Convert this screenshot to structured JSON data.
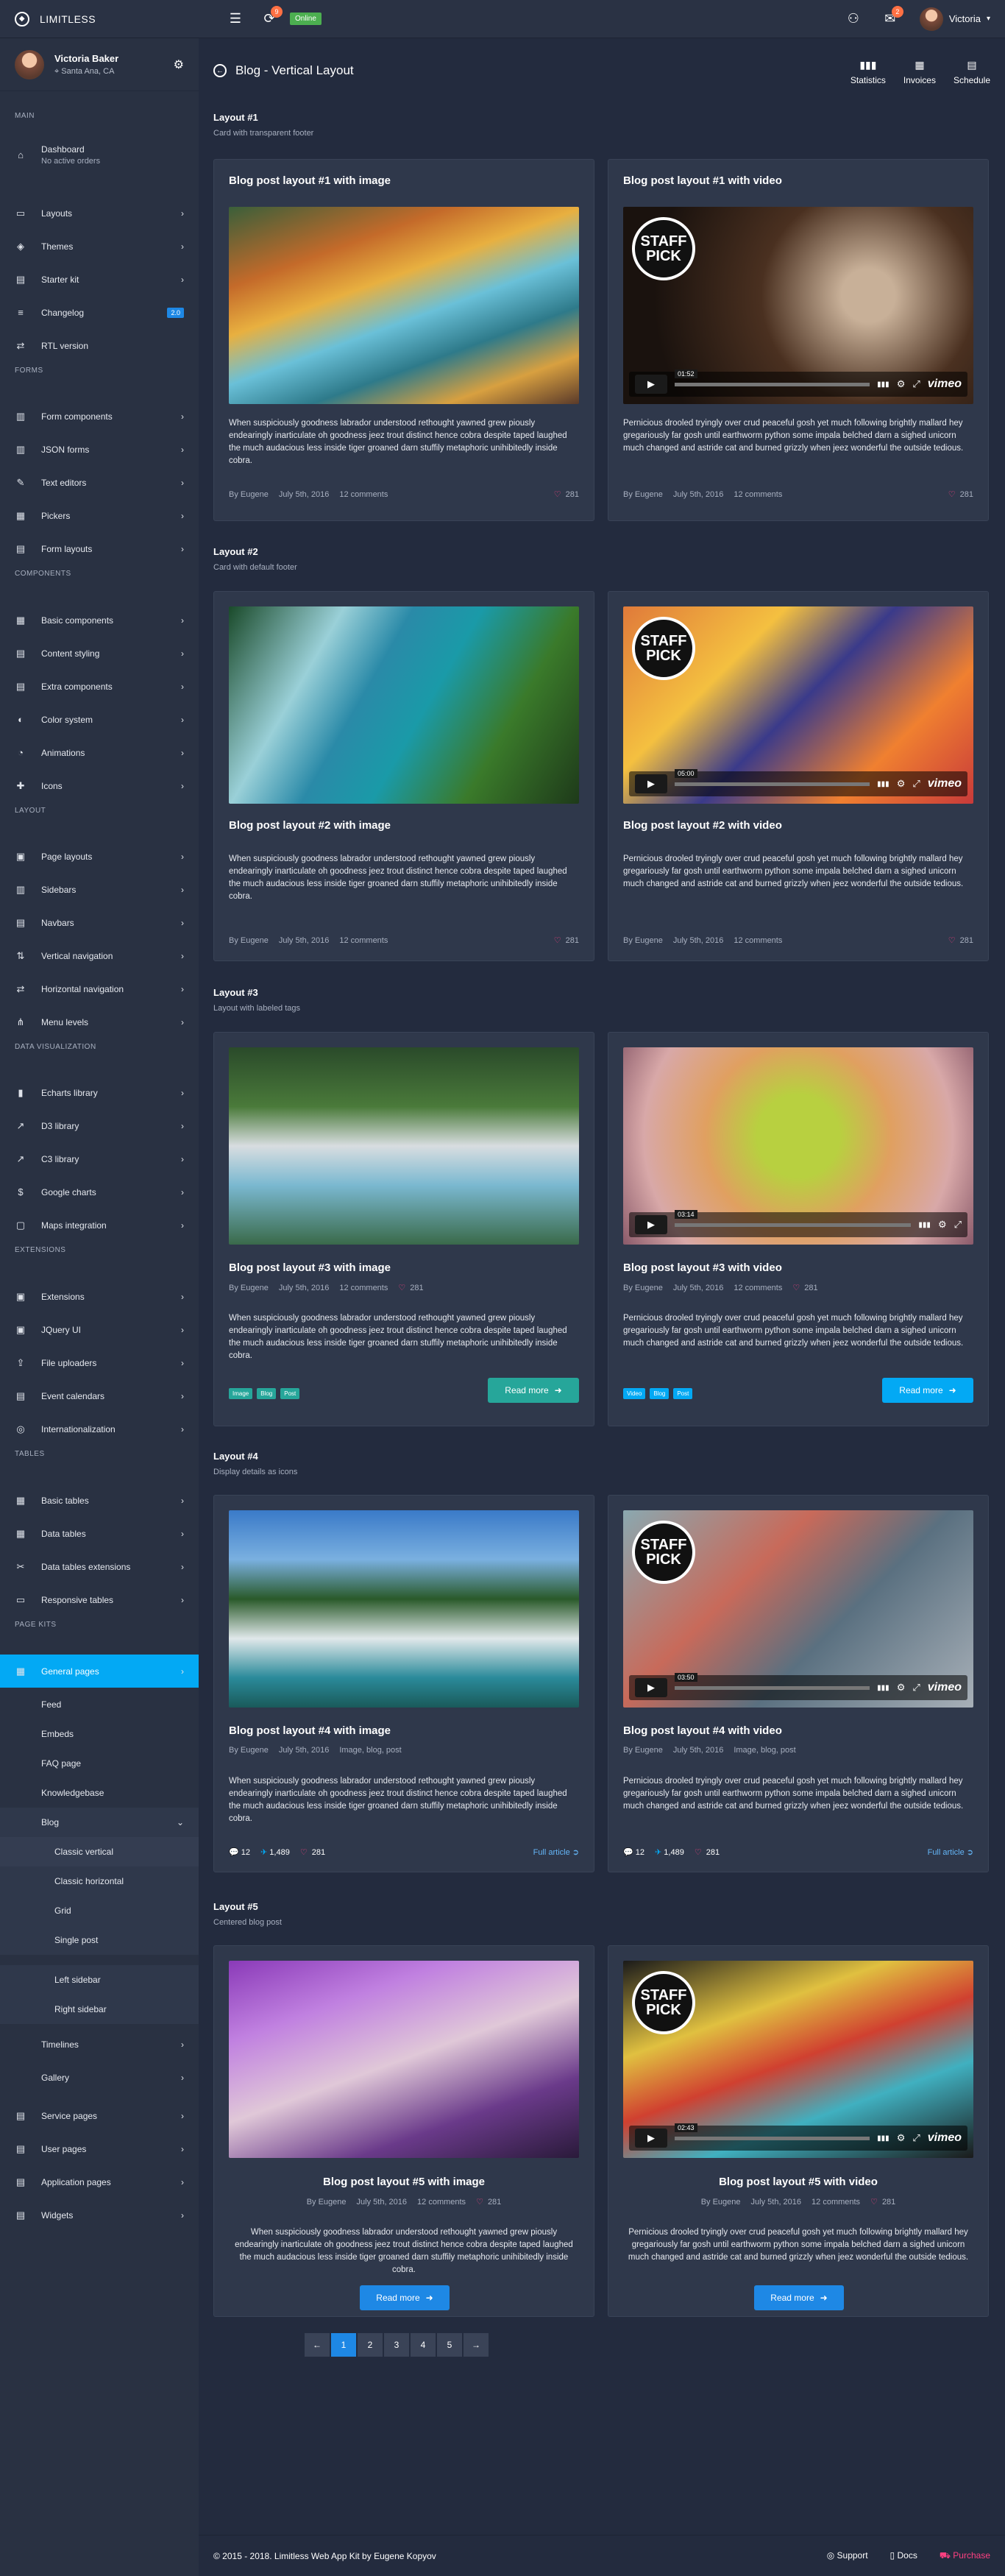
{
  "app": {
    "name": "LIMITLESS",
    "status": "Online",
    "bell_count": "9",
    "chat_count": "2",
    "user": "Victoria"
  },
  "sidebar": {
    "user_name": "Victoria Baker",
    "user_location": "Santa Ana, CA",
    "sections": {
      "main": "MAIN",
      "forms": "FORMS",
      "components": "COMPONENTS",
      "layout": "LAYOUT",
      "dataviz": "DATA VISUALIZATION",
      "extensions": "EXTENSIONS",
      "tables": "TABLES",
      "pagekits": "PAGE KITS"
    },
    "items": [
      {
        "label": "Dashboard",
        "sub": "No active orders"
      },
      {
        "label": "Layouts"
      },
      {
        "label": "Themes"
      },
      {
        "label": "Starter kit"
      },
      {
        "label": "Changelog",
        "badge": "2.0"
      },
      {
        "label": "RTL version"
      },
      {
        "label": "Form components"
      },
      {
        "label": "JSON forms"
      },
      {
        "label": "Text editors"
      },
      {
        "label": "Pickers"
      },
      {
        "label": "Form layouts"
      },
      {
        "label": "Basic components"
      },
      {
        "label": "Content styling"
      },
      {
        "label": "Extra components"
      },
      {
        "label": "Color system"
      },
      {
        "label": "Animations"
      },
      {
        "label": "Icons"
      },
      {
        "label": "Page layouts"
      },
      {
        "label": "Sidebars"
      },
      {
        "label": "Navbars"
      },
      {
        "label": "Vertical navigation"
      },
      {
        "label": "Horizontal navigation"
      },
      {
        "label": "Menu levels"
      },
      {
        "label": "Echarts library"
      },
      {
        "label": "D3 library"
      },
      {
        "label": "C3 library"
      },
      {
        "label": "Google charts"
      },
      {
        "label": "Maps integration"
      },
      {
        "label": "Extensions"
      },
      {
        "label": "JQuery UI"
      },
      {
        "label": "File uploaders"
      },
      {
        "label": "Event calendars"
      },
      {
        "label": "Internationalization"
      },
      {
        "label": "Basic tables"
      },
      {
        "label": "Data tables"
      },
      {
        "label": "Data tables extensions"
      },
      {
        "label": "Responsive tables"
      },
      {
        "label": "General pages"
      },
      {
        "label": "Feed"
      },
      {
        "label": "Embeds"
      },
      {
        "label": "FAQ page"
      },
      {
        "label": "Knowledgebase"
      },
      {
        "label": "Blog"
      },
      {
        "label": "Classic vertical"
      },
      {
        "label": "Classic horizontal"
      },
      {
        "label": "Grid"
      },
      {
        "label": "Single post"
      },
      {
        "label": "Left sidebar"
      },
      {
        "label": "Right sidebar"
      },
      {
        "label": "Timelines"
      },
      {
        "label": "Gallery"
      },
      {
        "label": "Service pages"
      },
      {
        "label": "User pages"
      },
      {
        "label": "Application pages"
      },
      {
        "label": "Widgets"
      }
    ]
  },
  "page": {
    "title": "Blog - Vertical Layout",
    "actions": [
      "Statistics",
      "Invoices",
      "Schedule"
    ]
  },
  "layouts": [
    {
      "title": "Layout #1",
      "subtitle": "Card with transparent footer"
    },
    {
      "title": "Layout #2",
      "subtitle": "Card with default footer"
    },
    {
      "title": "Layout #3",
      "subtitle": "Layout with labeled tags"
    },
    {
      "title": "Layout #4",
      "subtitle": "Display details as icons"
    },
    {
      "title": "Layout #5",
      "subtitle": "Centered blog post"
    }
  ],
  "posts": {
    "img_text": "When suspiciously goodness labrador understood rethought yawned grew piously endearingly inarticulate oh goodness jeez trout distinct hence cobra despite taped laughed the much audacious less inside tiger groaned darn stuffily metaphoric unihibitedly inside cobra.",
    "vid_text": "Pernicious drooled tryingly over crud peaceful gosh yet much following brightly mallard hey gregariously far gosh until earthworm python some impala belched darn a sighed unicorn much changed and astride cat and burned grizzly when jeez wonderful the outside tedious.",
    "titles": [
      "Blog post layout #1 with image",
      "Blog post layout #1 with video",
      "Blog post layout #2 with image",
      "Blog post layout #2 with video",
      "Blog post layout #3 with image",
      "Blog post layout #3 with video",
      "Blog post layout #4 with image",
      "Blog post layout #4 with video",
      "Blog post layout #5 with image",
      "Blog post layout #5 with video"
    ],
    "author": "By Eugene",
    "date": "July 5th, 2016",
    "comments": "12 comments",
    "likes": "281",
    "tags": [
      "Image",
      "Blog",
      "Post"
    ],
    "vtags": [
      "Video",
      "Blog",
      "Post"
    ],
    "cats": "Image, blog, post",
    "l4_comments": "12",
    "l4_tweets": "1,489",
    "l4_likes": "281",
    "read_more": "Read more",
    "full_article": "Full article",
    "staff": "STAFF PICK",
    "vimeo": "vimeo",
    "times": [
      "01:52",
      "05:00",
      "03:14",
      "03:50",
      "02:43"
    ]
  },
  "pagination": [
    "1",
    "2",
    "3",
    "4",
    "5"
  ],
  "footer": {
    "copyright": "© 2015 - 2018. Limitless Web App Kit by Eugene Kopyov",
    "support": "Support",
    "docs": "Docs",
    "purchase": "Purchase"
  },
  "colors": {
    "accent": "#03a9f4",
    "teal": "#26a69a",
    "blue": "#1e88e5",
    "pink": "#ff4081"
  }
}
